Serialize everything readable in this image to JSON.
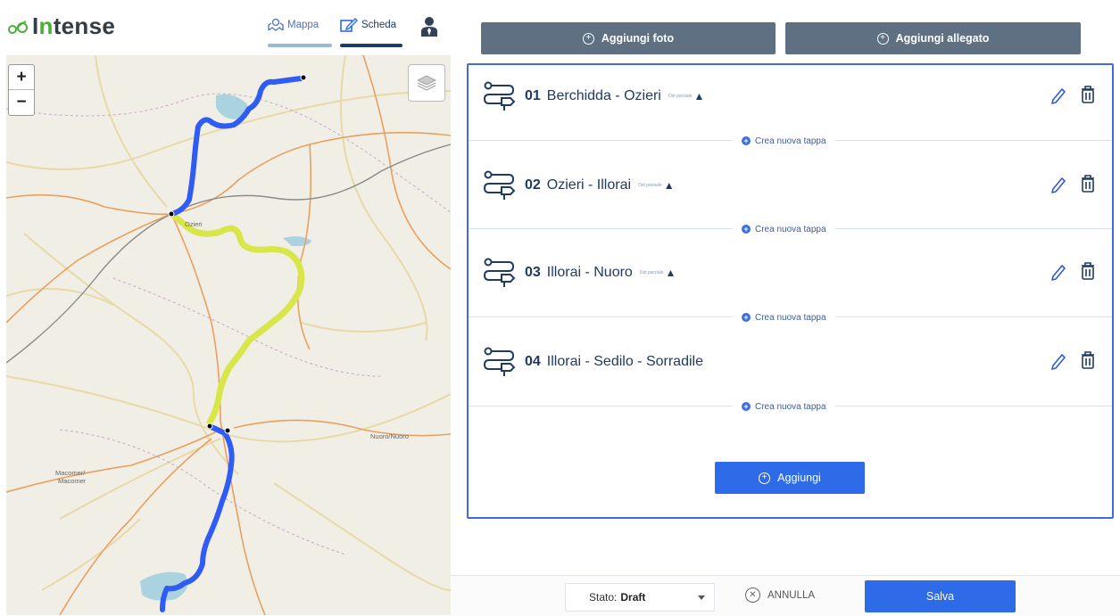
{
  "app": {
    "logo_prefix": "I",
    "logo_accent": "n",
    "logo_rest": "tense"
  },
  "nav": {
    "mappa": "Mappa",
    "scheda": "Scheda"
  },
  "map": {
    "zoom_in": "+",
    "zoom_out": "−",
    "places": {
      "ozieri": "Ozieri",
      "nuoro": "Nuoro/Nuoro",
      "macomer_1": "Macomer/",
      "macomer_2": "Macomer"
    },
    "route_colors": {
      "blue": "#2f5cf5",
      "yellow": "#d8e64a"
    }
  },
  "toolbar": {
    "add_photo": "Aggiungi foto",
    "add_attachment": "Aggiungi allegato"
  },
  "stages": [
    {
      "num": "01",
      "name": "Berchidda - Ozieri",
      "note": "Ost parziale",
      "warn": true
    },
    {
      "num": "02",
      "name": "Ozieri - Illorai",
      "note": "Ost parziale",
      "warn": true
    },
    {
      "num": "03",
      "name": "Illorai - Nuoro",
      "note": "Ost parziale",
      "warn": true
    },
    {
      "num": "04",
      "name": "Illorai - Sedilo - Sorradile",
      "note": "",
      "warn": false
    }
  ],
  "crea_label": "Crea nuova tappa",
  "add_button": "Aggiungi",
  "footer": {
    "stato_label": "Stato:",
    "stato_value": "Draft",
    "annulla": "ANNULLA",
    "salva": "Salva"
  },
  "colors": {
    "accent": "#2d6be8",
    "panel_border": "#4169e1",
    "toolbar_button": "#5f7083",
    "logo_green": "#4cae3a"
  }
}
